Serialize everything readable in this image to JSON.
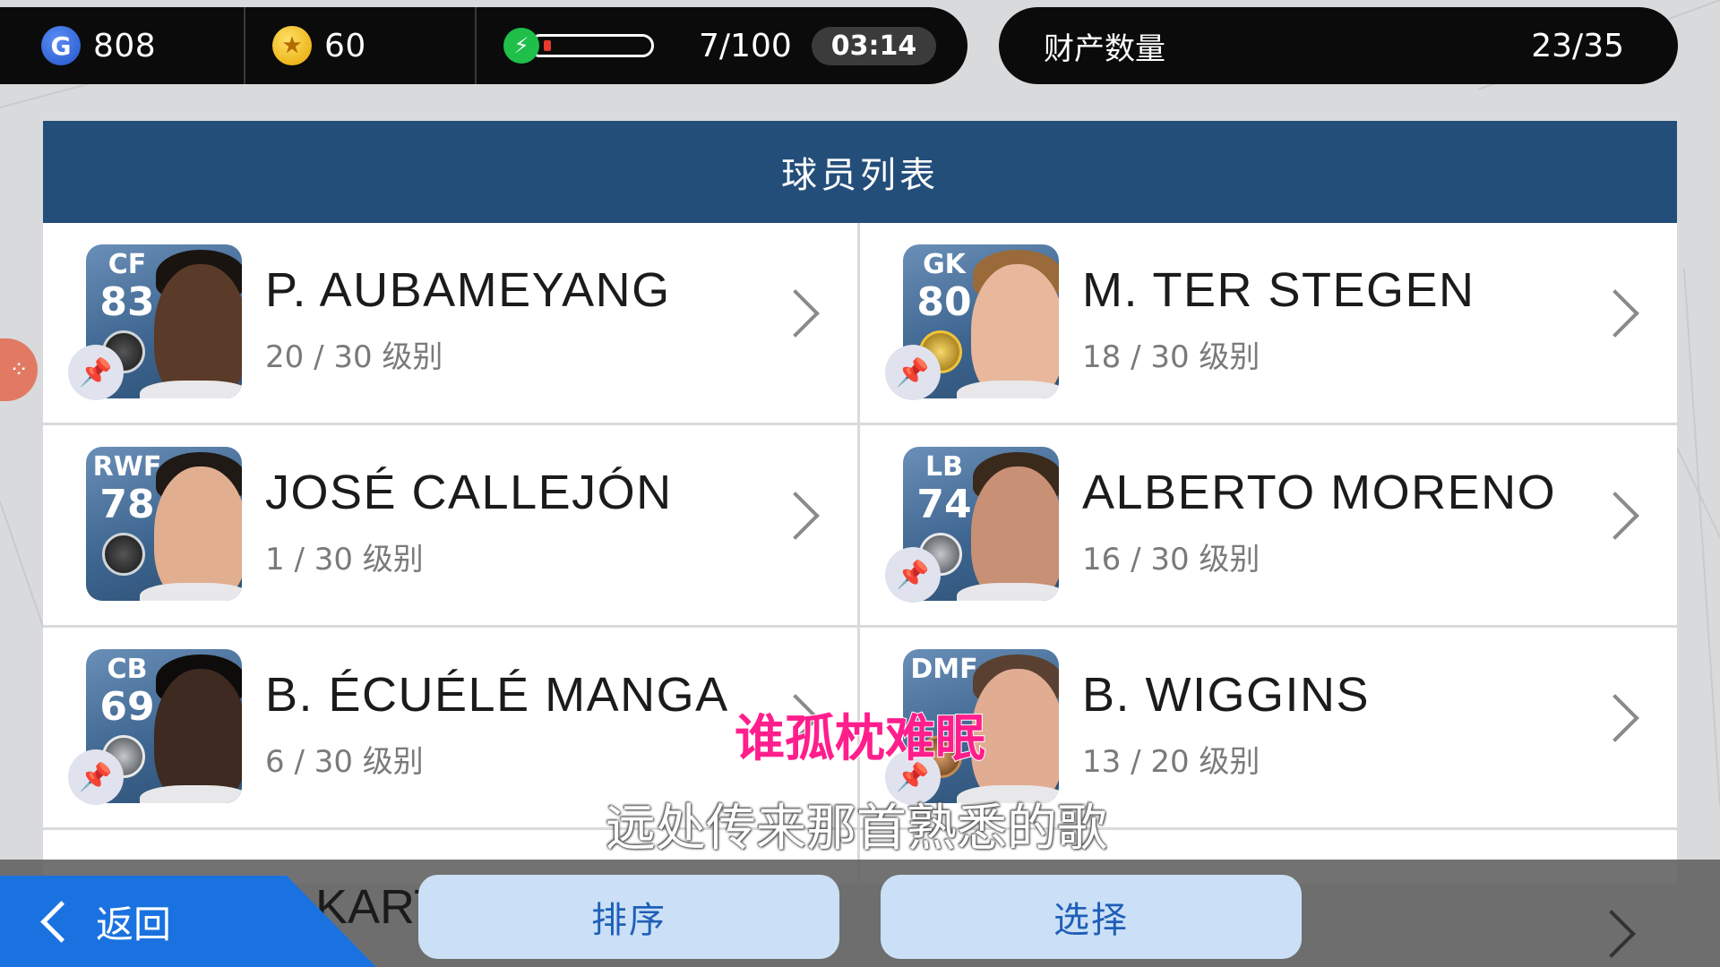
{
  "currency": {
    "gp_icon": "G",
    "gp": "808",
    "coin_icon": "★",
    "coins": "60"
  },
  "energy": {
    "icon": "⚡",
    "count": "7/100",
    "timer": "03:14",
    "level": 0.07,
    "color": "#1fbf4a"
  },
  "assets": {
    "label": "财产数量",
    "value": "23/35"
  },
  "panel": {
    "title": "球员列表"
  },
  "players": [
    {
      "position": "CF",
      "rating": "83",
      "name": "P. AUBAMEYANG",
      "level": "20 / 30 级别",
      "badge": "dark",
      "skin": "#5a3a28",
      "hair": "#1a1410",
      "pinned": true
    },
    {
      "position": "GK",
      "rating": "80",
      "name": "M. TER STEGEN",
      "level": "18 / 30 级别",
      "badge": "gold",
      "skin": "#e9b79c",
      "hair": "#9a6a3a",
      "pinned": true
    },
    {
      "position": "RWF",
      "rating": "78",
      "name": "JOSÉ CALLEJÓN",
      "level": "1 / 30 级别",
      "badge": "dark",
      "skin": "#e2ae90",
      "hair": "#1f1a16",
      "pinned": false
    },
    {
      "position": "LB",
      "rating": "74",
      "name": "ALBERTO MORENO",
      "level": "16 / 30 级别",
      "badge": "silver",
      "skin": "#c89074",
      "hair": "#3a2a1c",
      "pinned": true
    },
    {
      "position": "CB",
      "rating": "69",
      "name": "B. ÉCUÉLÉ MANGA",
      "level": "6 / 30 级别",
      "badge": "silver",
      "skin": "#3e2a20",
      "hair": "#0e0c0a",
      "pinned": true
    },
    {
      "position": "DMF",
      "rating": "",
      "name": "B. WIGGINS",
      "level": "13 / 20 级别",
      "badge": "bronze",
      "skin": "#e0ac92",
      "hair": "#5a4030",
      "pinned": true
    }
  ],
  "bottom": {
    "back_icon": "chevron-left",
    "back_label": "返回",
    "sort_label": "排序",
    "select_label": "选择",
    "partial_name": "KART",
    "partial_right": "-"
  },
  "pin_icon": "📌",
  "subtitles": {
    "line1": "谁孤枕难眠",
    "line2": "远处传来那首熟悉的歌"
  }
}
